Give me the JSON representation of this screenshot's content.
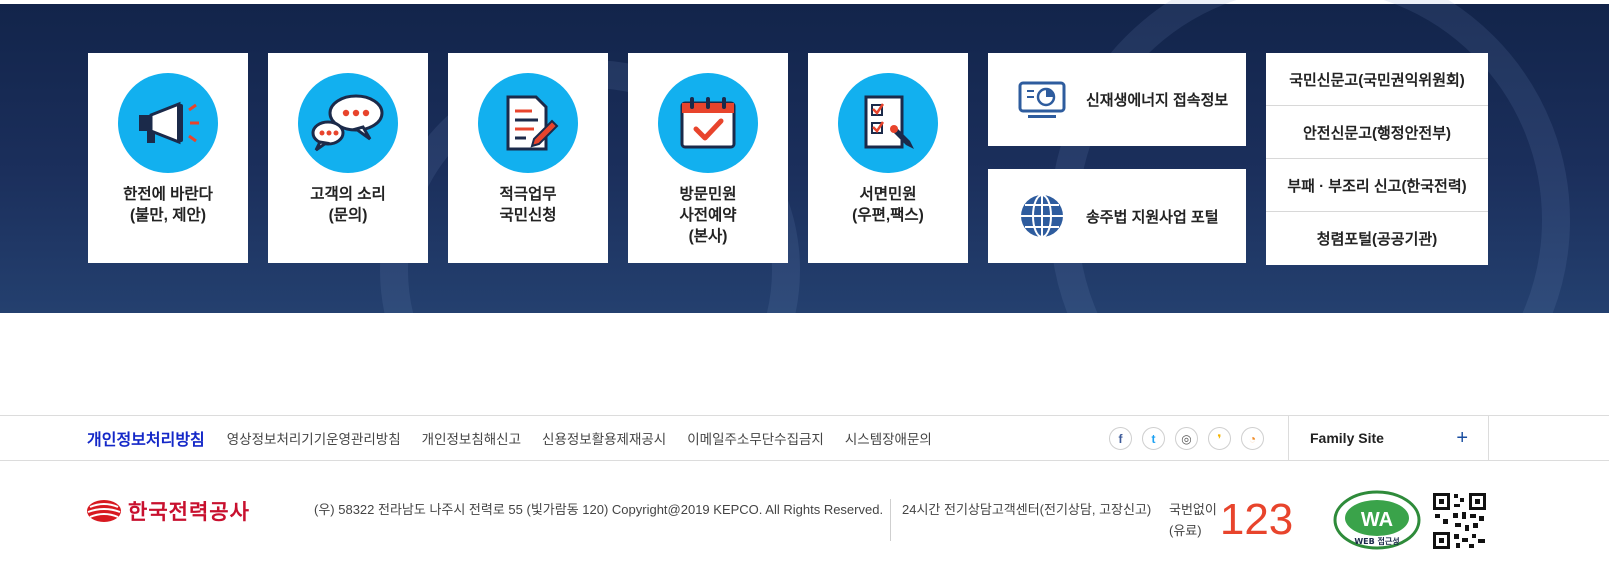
{
  "banner": {
    "cards": [
      {
        "label": "한전에 바란다\n(불만, 제안)",
        "icon": "megaphone-icon"
      },
      {
        "label": "고객의 소리\n(문의)",
        "icon": "speech-bubbles-icon"
      },
      {
        "label": "적극업무\n국민신청",
        "icon": "document-pen-icon"
      },
      {
        "label": "방문민원\n사전예약\n(본사)",
        "icon": "calendar-check-icon"
      },
      {
        "label": "서면민원\n(우편,팩스)",
        "icon": "checklist-pen-icon"
      }
    ],
    "wide_cards": [
      {
        "label": "신재생에너지 접속정보",
        "icon": "monitor-chart-icon"
      },
      {
        "label": "송주법 지원사업 포털",
        "icon": "globe-icon"
      }
    ],
    "report_links": [
      "국민신문고(국민권익위원회)",
      "안전신문고(행정안전부)",
      "부패 · 부조리 신고(한국전력)",
      "청렴포털(공공기관)"
    ]
  },
  "footer_nav": {
    "primary_link": "개인정보처리방침",
    "links": [
      "영상정보처리기기운영관리방침",
      "개인정보침해신고",
      "신용정보활용제재공시",
      "이메일주소무단수집금지",
      "시스템장애문의"
    ],
    "social": [
      {
        "name": "facebook-icon",
        "glyph": "f",
        "color": "#3b5998"
      },
      {
        "name": "twitter-icon",
        "glyph": "t",
        "color": "#1da1f2"
      },
      {
        "name": "instagram-icon",
        "glyph": "◎",
        "color": "#555555"
      },
      {
        "name": "kakaostory-icon",
        "glyph": "❜",
        "color": "#f5b400"
      },
      {
        "name": "rss-icon",
        "glyph": "◔",
        "color": "#f08a24"
      }
    ],
    "family_site": "Family Site",
    "family_plus": "+"
  },
  "footer": {
    "logo_text": "한국전력공사",
    "address": "(우) 58322 전라남도 나주시 전력로 55 (빛가람동 120) Copyright@2019 KEPCO. All Rights Reserved.",
    "call_center": "24시간 전기상담고객센터(전기상담, 고장신고)",
    "call_prefix": "국번없이\n(유료)",
    "call_number": "123",
    "wa_badge": "WA",
    "wa_caption": "WEB 접근성"
  },
  "colors": {
    "accent_blue": "#12b0ef",
    "nav_primary": "#1428c8",
    "call_red": "#e8442c",
    "banner_bg": "#1b2f5c"
  }
}
